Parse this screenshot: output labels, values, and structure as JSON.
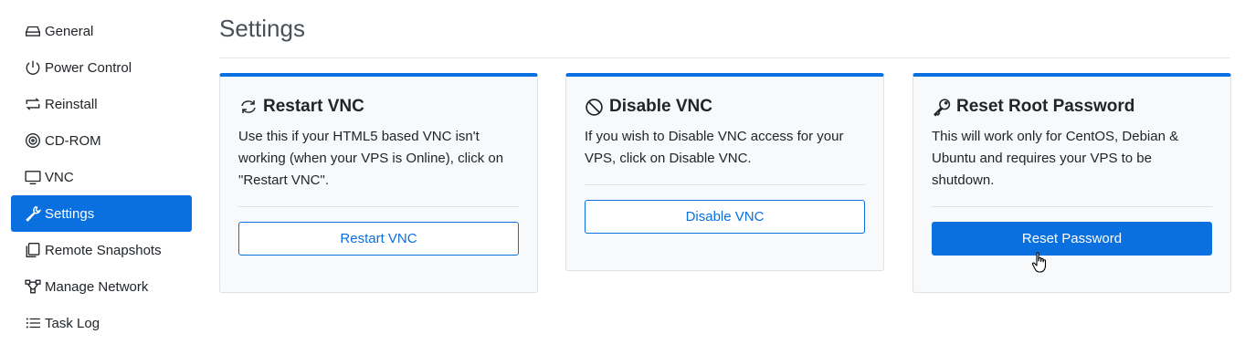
{
  "sidebar": {
    "items": [
      {
        "label": "General",
        "icon": "hdd-icon"
      },
      {
        "label": "Power Control",
        "icon": "power-icon"
      },
      {
        "label": "Reinstall",
        "icon": "repeat-icon"
      },
      {
        "label": "CD-ROM",
        "icon": "disc-icon"
      },
      {
        "label": "VNC",
        "icon": "monitor-icon"
      },
      {
        "label": "Settings",
        "icon": "wrench-icon",
        "active": true
      },
      {
        "label": "Remote Snapshots",
        "icon": "copy-icon"
      },
      {
        "label": "Manage Network",
        "icon": "network-icon"
      },
      {
        "label": "Task Log",
        "icon": "list-icon"
      }
    ]
  },
  "header": {
    "title": "Settings"
  },
  "cards": [
    {
      "title": "Restart VNC",
      "icon": "refresh-icon",
      "description": "Use this if your HTML5 based VNC isn't working (when your VPS is Online), click on \"Restart VNC\".",
      "button": "Restart VNC"
    },
    {
      "title": "Disable VNC",
      "icon": "ban-icon",
      "description": "If you wish to Disable VNC access for your VPS, click on Disable VNC.",
      "button": "Disable VNC"
    },
    {
      "title": "Reset Root Password",
      "icon": "key-icon",
      "description": "This will work only for CentOS, Debian & Ubuntu and requires your VPS to be shutdown.",
      "button": "Reset Password"
    }
  ],
  "colors": {
    "accent": "#0a6fdf",
    "card_bg": "#f8f9fa"
  }
}
